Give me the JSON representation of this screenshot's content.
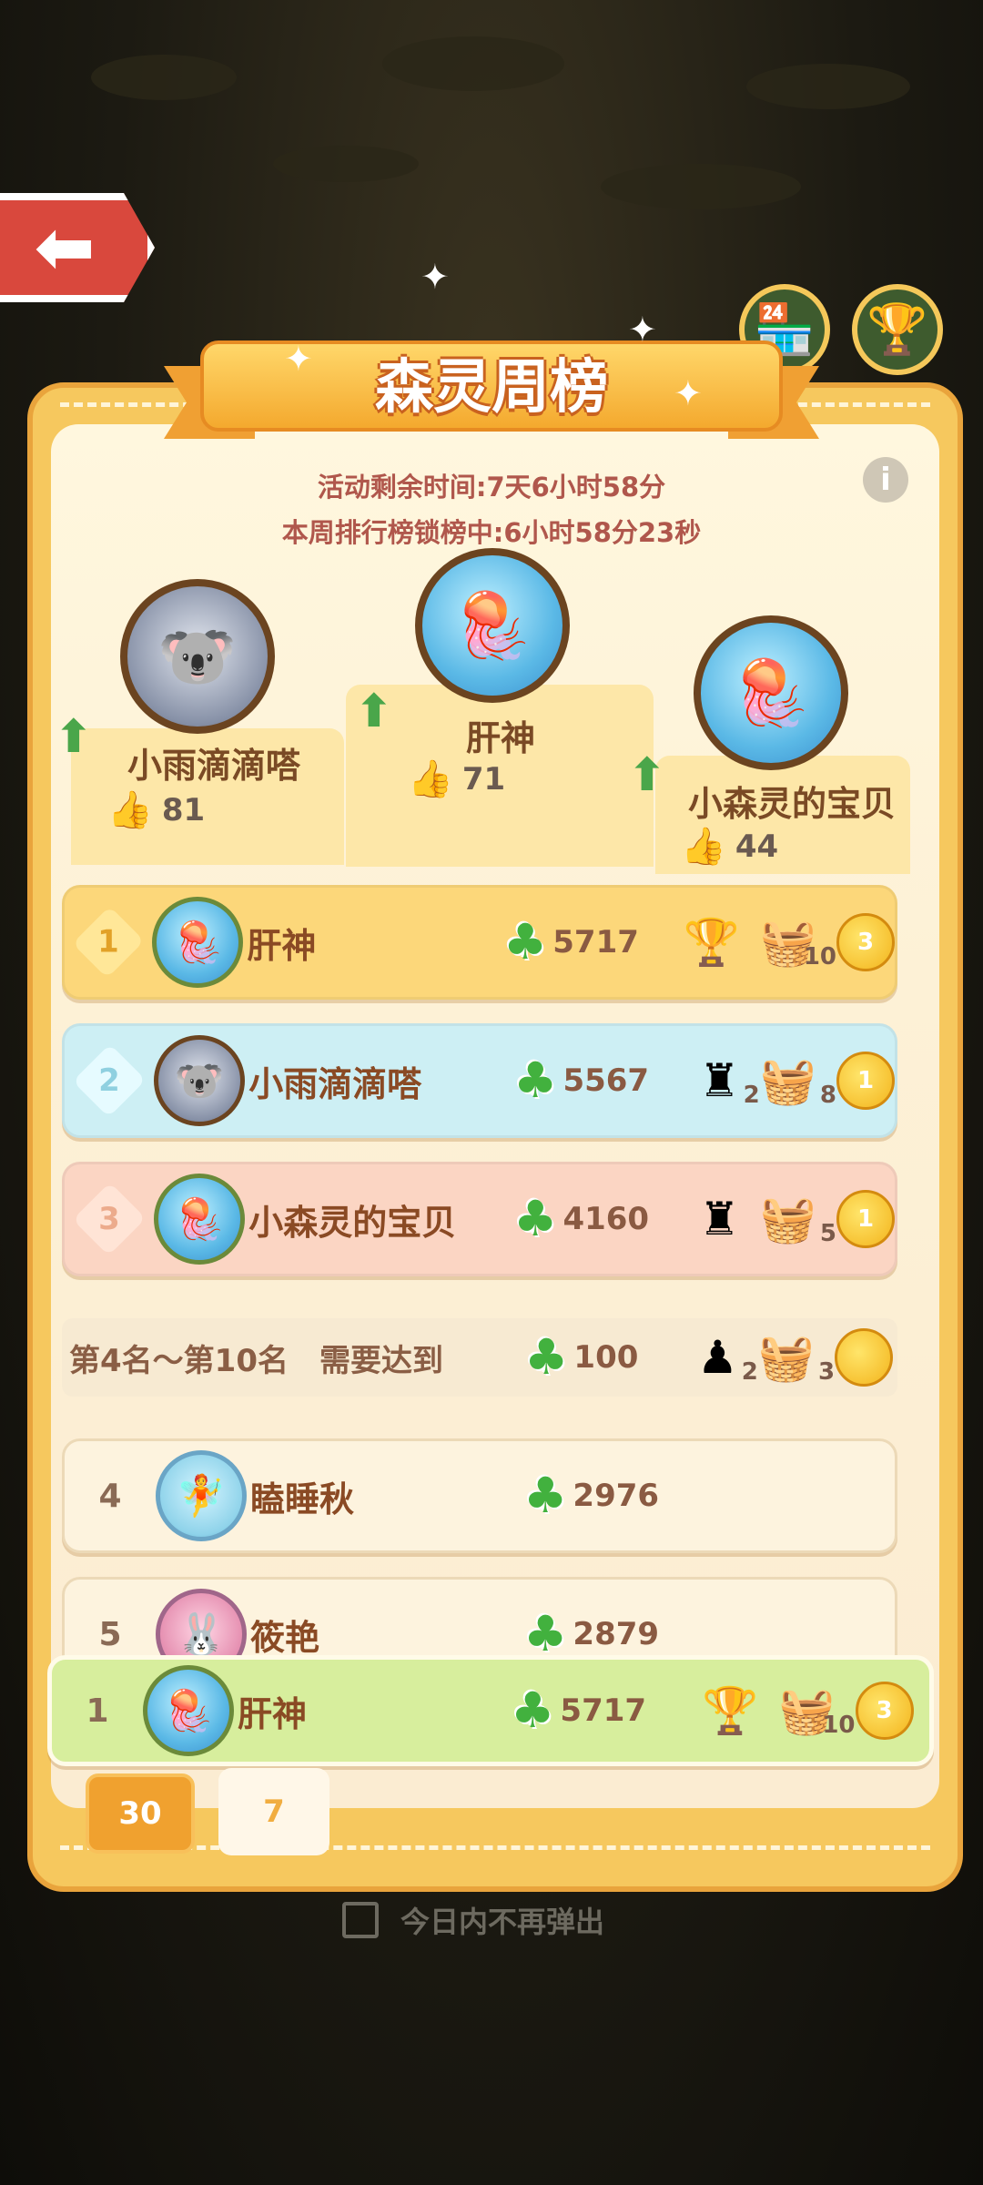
{
  "header": {
    "title": "森灵周榜",
    "back_icon": "left-arrow-icon",
    "shop_icon": "shop-icon",
    "trophy_icon": "trophy-icon"
  },
  "timers": {
    "remaining": "活动剩余时间:7天6小时58分",
    "lock": "本周排行榜锁榜中:6小时58分23秒"
  },
  "podium": [
    {
      "rank": 2,
      "name": "小雨滴滴嗒",
      "likes": "81"
    },
    {
      "rank": 1,
      "name": "肝神",
      "likes": "71"
    },
    {
      "rank": 3,
      "name": "小森灵的宝贝",
      "likes": "44"
    }
  ],
  "top_rows": [
    {
      "rank": "1",
      "name": "肝神",
      "score": "5717",
      "trophy_icon": "blue-cup-icon",
      "basket_qty": "10",
      "coin": "3"
    },
    {
      "rank": "2",
      "name": "小雨滴滴嗒",
      "score": "5567",
      "trophy_qty": "2",
      "basket_qty": "8",
      "coin": "1"
    },
    {
      "rank": "3",
      "name": "小森灵的宝贝",
      "score": "4160",
      "trophy_qty": "",
      "basket_qty": "5",
      "coin": "1"
    }
  ],
  "threshold": {
    "text": "第4名～第10名　需要达到",
    "score": "100",
    "trophy_qty": "2",
    "basket_qty": "3"
  },
  "rows": [
    {
      "rank": "4",
      "name": "瞌睡秋",
      "score": "2976"
    },
    {
      "rank": "5",
      "name": "筱艳",
      "score": "2879"
    }
  ],
  "my_row": {
    "rank": "1",
    "name": "肝神",
    "score": "5717",
    "basket_qty": "10",
    "coin": "3"
  },
  "tabs": [
    {
      "label": "30",
      "icon": "calendar-30-icon",
      "active": true
    },
    {
      "label": "7",
      "icon": "calendar-7-icon",
      "active": false
    }
  ],
  "footer": {
    "checkbox_label": "今日内不再弹出"
  },
  "colors": {
    "panel": "#f6c85e",
    "gold_row": "#fcd77a",
    "silver_row": "#cdeff4",
    "bronze_row": "#fbd5c3",
    "my_row": "#d7ee9d",
    "clover": "#42b13e"
  }
}
